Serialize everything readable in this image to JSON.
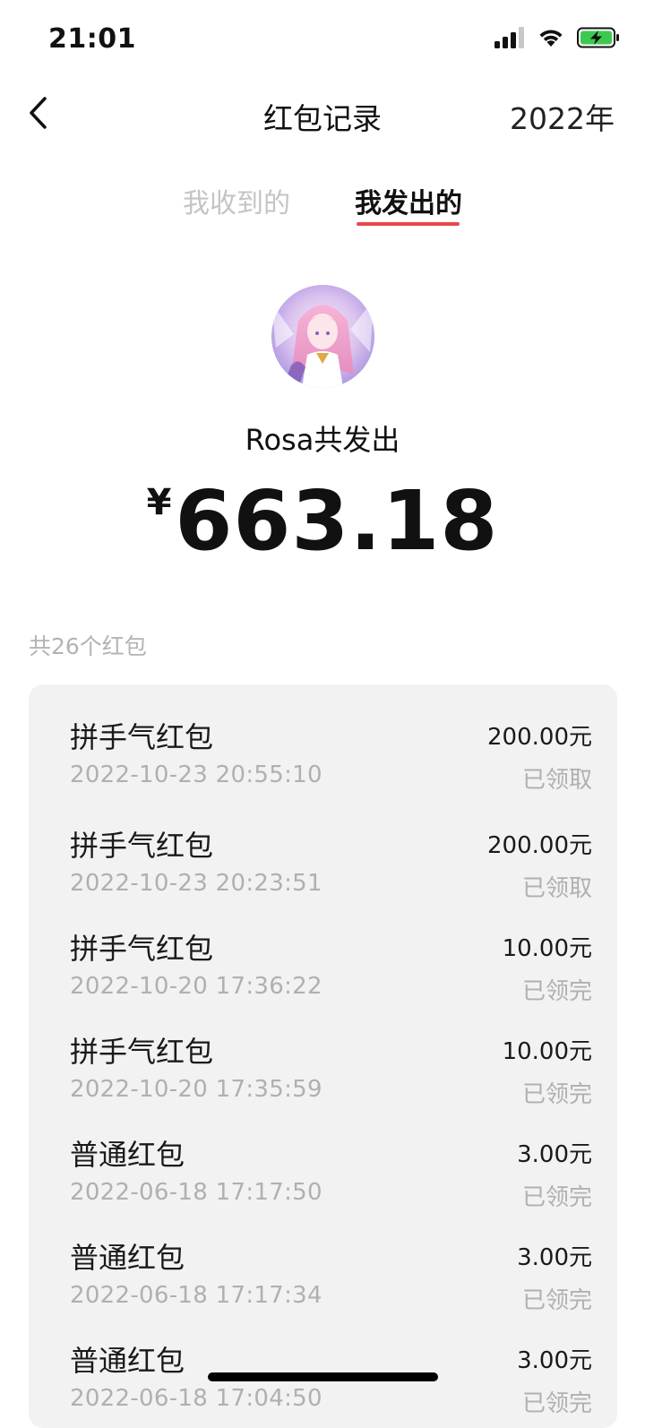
{
  "status_bar": {
    "time": "21:01",
    "icons": [
      "signal-icon",
      "wifi-icon",
      "battery-charging-icon"
    ]
  },
  "nav": {
    "back_icon": "chevron-left-icon",
    "title": "红包记录",
    "year": "2022年"
  },
  "tabs": [
    {
      "label": "我收到的",
      "active": false
    },
    {
      "label": "我发出的",
      "active": true
    }
  ],
  "colors": {
    "accent": "#e8474b",
    "muted_text": "#b0b0b0",
    "card_background": "#f2f2f2"
  },
  "summary": {
    "sender_label": "Rosa共发出",
    "currency_symbol": "¥",
    "total": "663.18",
    "count_label": "共26个红包"
  },
  "records": [
    {
      "type": "拼手气红包",
      "time": "2022-10-23 20:55:10",
      "amount": "200.00元",
      "status": "已领取"
    },
    {
      "type": "拼手气红包",
      "time": "2022-10-23 20:23:51",
      "amount": "200.00元",
      "status": "已领取"
    },
    {
      "type": "拼手气红包",
      "time": "2022-10-20 17:36:22",
      "amount": "10.00元",
      "status": "已领完"
    },
    {
      "type": "拼手气红包",
      "time": "2022-10-20 17:35:59",
      "amount": "10.00元",
      "status": "已领完"
    },
    {
      "type": "普通红包",
      "time": "2022-06-18 17:17:50",
      "amount": "3.00元",
      "status": "已领完"
    },
    {
      "type": "普通红包",
      "time": "2022-06-18 17:17:34",
      "amount": "3.00元",
      "status": "已领完"
    },
    {
      "type": "普通红包",
      "time": "2022-06-18 17:04:50",
      "amount": "3.00元",
      "status": "已领完"
    }
  ]
}
